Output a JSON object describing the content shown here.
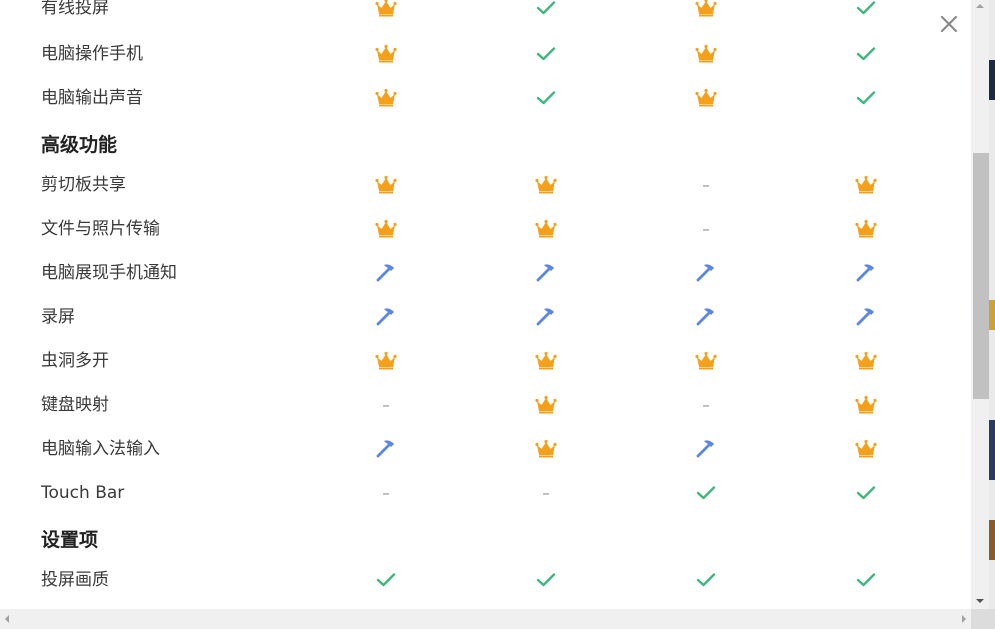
{
  "close_icon": "close-icon",
  "legend_icons": {
    "crown": {
      "name": "crown-icon",
      "color": "#f5a01a"
    },
    "check": {
      "name": "check-icon",
      "color": "#3fb77a"
    },
    "hammer": {
      "name": "hammer-icon",
      "color": "#5b86e5"
    },
    "dash": {
      "name": "dash-icon",
      "text": "–",
      "color": "#888888"
    }
  },
  "sections": [
    {
      "title": "",
      "rows": [
        {
          "label": "有线投屏",
          "cells": [
            "crown",
            "check",
            "crown",
            "check"
          ]
        },
        {
          "label": "电脑操作手机",
          "cells": [
            "crown",
            "check",
            "crown",
            "check"
          ]
        },
        {
          "label": "电脑输出声音",
          "cells": [
            "crown",
            "check",
            "crown",
            "check"
          ]
        }
      ]
    },
    {
      "title": "高级功能",
      "rows": [
        {
          "label": "剪切板共享",
          "cells": [
            "crown",
            "crown",
            "dash",
            "crown"
          ]
        },
        {
          "label": "文件与照片传输",
          "cells": [
            "crown",
            "crown",
            "dash",
            "crown"
          ]
        },
        {
          "label": "电脑展现手机通知",
          "cells": [
            "hammer",
            "hammer",
            "hammer",
            "hammer"
          ]
        },
        {
          "label": "录屏",
          "cells": [
            "hammer",
            "hammer",
            "hammer",
            "hammer"
          ]
        },
        {
          "label": "虫洞多开",
          "cells": [
            "crown",
            "crown",
            "crown",
            "crown"
          ]
        },
        {
          "label": "键盘映射",
          "cells": [
            "dash",
            "crown",
            "dash",
            "crown"
          ]
        },
        {
          "label": "电脑输入法输入",
          "cells": [
            "hammer",
            "crown",
            "hammer",
            "crown"
          ]
        },
        {
          "label": "Touch Bar",
          "cells": [
            "dash",
            "dash",
            "check",
            "check"
          ]
        }
      ]
    },
    {
      "title": "设置项",
      "rows": [
        {
          "label": "投屏画质",
          "cells": [
            "check",
            "check",
            "check",
            "check"
          ]
        }
      ]
    }
  ]
}
